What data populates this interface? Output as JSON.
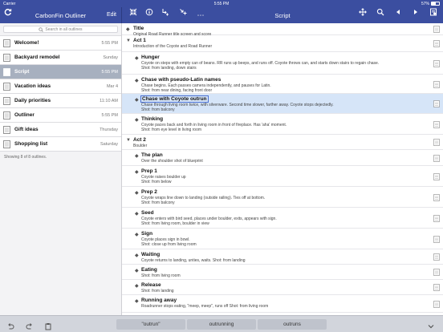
{
  "status": {
    "carrier": "Carrier",
    "time": "5:55 PM",
    "battery": "57%"
  },
  "sidebar": {
    "title": "CarbonFin Outliner",
    "edit_label": "Edit",
    "search_placeholder": "Search in all outlines",
    "items": [
      {
        "name": "Welcome!",
        "date": "5:55 PM"
      },
      {
        "name": "Backyard remodel",
        "date": "Sunday"
      },
      {
        "name": "Script",
        "date": "5:55 PM"
      },
      {
        "name": "Vacation ideas",
        "date": "Mar 4"
      },
      {
        "name": "Daily priorities",
        "date": "11:10 AM"
      },
      {
        "name": "Outliner",
        "date": "5:55 PM"
      },
      {
        "name": "Gift ideas",
        "date": "Thursday"
      },
      {
        "name": "Shopping list",
        "date": "Saturday"
      }
    ],
    "footer": "Showing 8 of 8 outlines."
  },
  "main": {
    "title": "Script",
    "rows": [
      {
        "title": "Title",
        "notes": [
          "Original Road Runner title screen and score"
        ],
        "handle": "◆"
      },
      {
        "title": "Act 1",
        "notes": [
          "Introduction of the Coyote and Road Runner"
        ],
        "handle": "▼"
      },
      {
        "title": "Hunger",
        "notes": [
          "Coyote on steps with empty can of beans. RR runs up beeps, and runs off. Coyote throws can, and starts down stairs to regain chase.",
          "Shot: from landing, down stairs"
        ],
        "handle": "◆"
      },
      {
        "title": "Chase with pseudo-Latin names",
        "notes": [
          "Chase begins. Each passes camera independently, and pauses for Latin.",
          "Shot: from near dining, facing front door"
        ],
        "handle": "◆"
      },
      {
        "title": "Chase with Coyote outrun",
        "notes": [
          "Chase through living room twice, with silverware. Second time slower, farther away. Coyote stops dejectedly.",
          "Shot: from balcony"
        ],
        "handle": "◆"
      },
      {
        "title": "Thinking",
        "notes": [
          "Coyote paces back and forth in living room in front of fireplace. Has 'aha' moment.",
          "Shot: from eye level in living room"
        ],
        "handle": "◆"
      },
      {
        "title": "Act 2",
        "notes": [
          "Boulder"
        ],
        "handle": "▼"
      },
      {
        "title": "The plan",
        "notes": [
          "Over the shoulder shot of blueprint"
        ],
        "handle": "◆"
      },
      {
        "title": "Prep 1",
        "notes": [
          "Coyote raises boulder up",
          "Shot: from below"
        ],
        "handle": "◆"
      },
      {
        "title": "Prep 2",
        "notes": [
          "Coyote wraps line down to landing (outside railing). Ties off at bottom.",
          "Shot: from balcony"
        ],
        "handle": "◆"
      },
      {
        "title": "Seed",
        "notes": [
          "Coyote enters with bird seed, places under boulder, exits, appears with sign.",
          "Shot: from living room, boulder in view"
        ],
        "handle": "◆"
      },
      {
        "title": "Sign",
        "notes": [
          "Coyote places sign in bowl.",
          "Shot: close up from living room"
        ],
        "handle": "◆"
      },
      {
        "title": "Waiting",
        "notes": [
          "Coyote returns to landing, unties, waits.  Shot: from landing"
        ],
        "handle": "◆"
      },
      {
        "title": "Eating",
        "notes": [
          "Shot: from living room"
        ],
        "handle": "◆"
      },
      {
        "title": "Release",
        "notes": [
          "Shot: from landing"
        ],
        "handle": "◆"
      },
      {
        "title": "Running away",
        "notes": [
          "Roadrunner stops eating, \"meep, meep\", runs off  Shot: from living room"
        ],
        "handle": "◆"
      }
    ]
  },
  "keyboard": {
    "suggestions": [
      "\"outrun\"",
      "outrunning",
      "outruns"
    ]
  },
  "colors": {
    "accent": "#3b4ea0",
    "selected_row": "#d6e5f8",
    "sidebar_selected": "#a7b0bf"
  }
}
